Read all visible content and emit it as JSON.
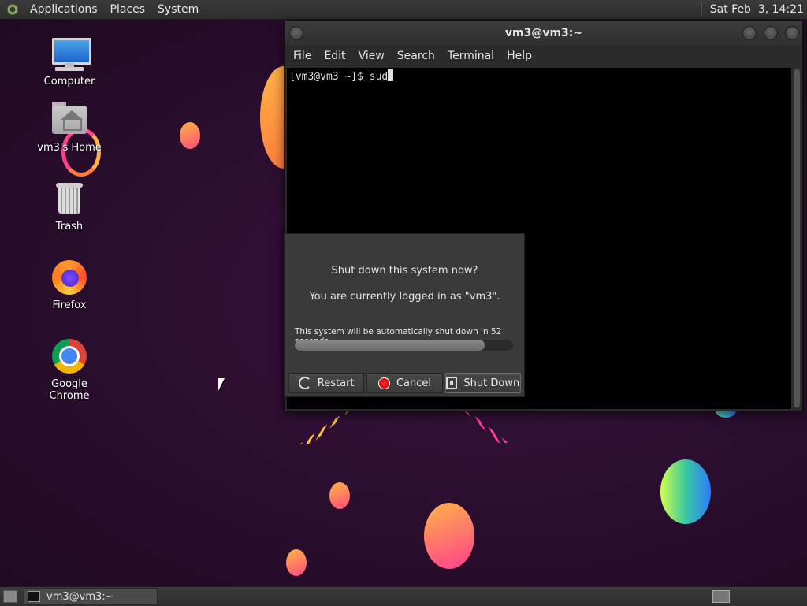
{
  "top_panel": {
    "menus": [
      "Applications",
      "Places",
      "System"
    ],
    "clock": "Sat Feb  3, 14:21"
  },
  "desktop_icons": [
    {
      "label": "Computer"
    },
    {
      "label": "vm3's Home"
    },
    {
      "label": "Trash"
    },
    {
      "label": "Firefox"
    },
    {
      "label": "Google Chrome"
    }
  ],
  "terminal": {
    "title": "vm3@vm3:~",
    "menu": [
      "File",
      "Edit",
      "View",
      "Search",
      "Terminal",
      "Help"
    ],
    "prompt": "[vm3@vm3 ~]$ ",
    "input": "sud"
  },
  "shutdown_dialog": {
    "question": "Shut down this system now?",
    "logged_in": "You are currently logged in as \"vm3\".",
    "countdown": "This system will be automatically shut down in 52 seconds",
    "progress_percent": 87,
    "buttons": {
      "restart": "Restart",
      "cancel": "Cancel",
      "shutdown": "Shut Down"
    }
  },
  "bottom_panel": {
    "task_label": "vm3@vm3:~"
  },
  "colors": {
    "panel": "#2e2e2e",
    "terminal_bg": "#000000",
    "dialog_bg": "#3a3a3a",
    "desktop_bg": "#2a0e2e"
  }
}
